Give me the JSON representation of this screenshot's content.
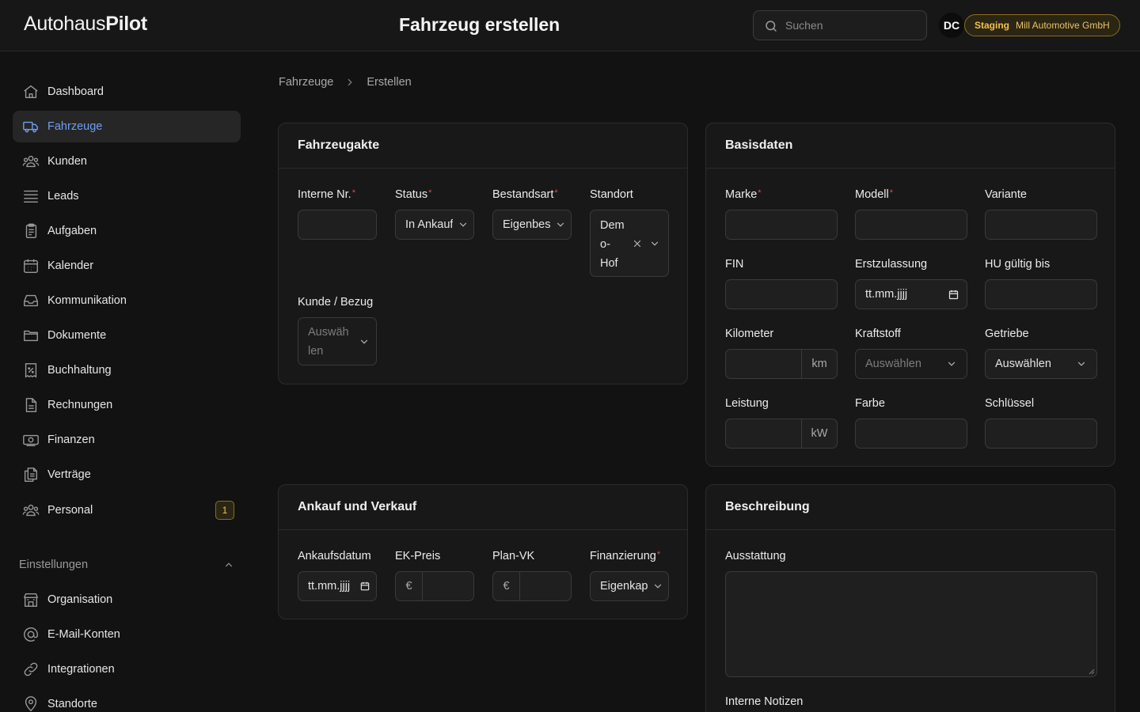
{
  "header": {
    "logo_regular": "Autohaus",
    "logo_bold": "Pilot",
    "title": "Fahrzeug erstellen",
    "search_placeholder": "Suchen",
    "avatar_initials": "DC",
    "env_label": "Staging",
    "org_name": "Mill Automotive GmbH"
  },
  "sidebar": {
    "items": [
      {
        "label": "Dashboard",
        "icon": "home-icon"
      },
      {
        "label": "Fahrzeuge",
        "icon": "truck-icon",
        "active": true
      },
      {
        "label": "Kunden",
        "icon": "users-icon"
      },
      {
        "label": "Leads",
        "icon": "list-icon"
      },
      {
        "label": "Aufgaben",
        "icon": "clipboard-icon"
      },
      {
        "label": "Kalender",
        "icon": "calendar-icon"
      },
      {
        "label": "Kommunikation",
        "icon": "inbox-icon"
      },
      {
        "label": "Dokumente",
        "icon": "folder-icon"
      },
      {
        "label": "Buchhaltung",
        "icon": "receipt-percent-icon"
      },
      {
        "label": "Rechnungen",
        "icon": "document-icon"
      },
      {
        "label": "Finanzen",
        "icon": "banknote-icon"
      },
      {
        "label": "Verträge",
        "icon": "documents-icon"
      },
      {
        "label": "Personal",
        "icon": "users-icon",
        "badge": "1"
      }
    ],
    "settings_section": "Einstellungen",
    "settings_items": [
      {
        "label": "Organisation",
        "icon": "building-icon"
      },
      {
        "label": "E-Mail-Konten",
        "icon": "at-icon"
      },
      {
        "label": "Integrationen",
        "icon": "link-icon"
      },
      {
        "label": "Standorte",
        "icon": "map-pin-icon"
      }
    ]
  },
  "breadcrumb": {
    "parent": "Fahrzeuge",
    "current": "Erstellen"
  },
  "fahrzeugakte": {
    "title": "Fahrzeugakte",
    "interne_nr": {
      "label": "Interne Nr.",
      "value": ""
    },
    "status": {
      "label": "Status",
      "value": "In Ankauf"
    },
    "bestandsart": {
      "label": "Bestandsart",
      "value": "Eigenbestand"
    },
    "standort": {
      "label": "Standort",
      "value_lines": [
        "Dem",
        "o-",
        "Hof"
      ]
    },
    "kunde": {
      "label": "Kunde / Bezug",
      "placeholder_lines": [
        "Auswäh",
        "len"
      ]
    }
  },
  "basisdaten": {
    "title": "Basisdaten",
    "marke": {
      "label": "Marke"
    },
    "modell": {
      "label": "Modell"
    },
    "variante": {
      "label": "Variante"
    },
    "fin": {
      "label": "FIN"
    },
    "erstzulassung": {
      "label": "Erstzulassung",
      "placeholder": "tt.mm.jjjj"
    },
    "hu": {
      "label": "HU gültig bis"
    },
    "kilometer": {
      "label": "Kilometer",
      "unit": "km"
    },
    "kraftstoff": {
      "label": "Kraftstoff",
      "placeholder": "Auswählen"
    },
    "getriebe": {
      "label": "Getriebe",
      "value": "Auswählen"
    },
    "leistung": {
      "label": "Leistung",
      "unit": "kW"
    },
    "farbe": {
      "label": "Farbe"
    },
    "schluessel": {
      "label": "Schlüssel"
    }
  },
  "ankauf": {
    "title": "Ankauf und Verkauf",
    "ankaufsdatum": {
      "label": "Ankaufsdatum",
      "placeholder": "tt.mm.jjjj"
    },
    "ek_preis": {
      "label": "EK-Preis",
      "currency": "€"
    },
    "plan_vk": {
      "label": "Plan-VK",
      "currency": "€"
    },
    "finanzierung": {
      "label": "Finanzierung",
      "value": "Eigenkapital"
    }
  },
  "beschreibung": {
    "title": "Beschreibung",
    "ausstattung": {
      "label": "Ausstattung"
    },
    "notizen": {
      "label": "Interne Notizen"
    }
  }
}
